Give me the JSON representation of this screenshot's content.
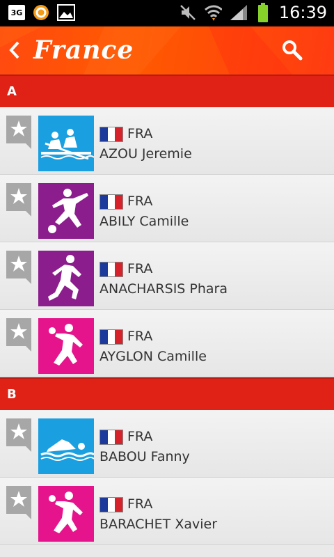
{
  "status_bar": {
    "network_badge": "3G",
    "time": "16:39",
    "icons": [
      "3g-icon",
      "circle-app-icon",
      "image-icon",
      "mute-icon",
      "wifi-icon",
      "signal-icon",
      "battery-icon"
    ],
    "battery_color": "#86d22b"
  },
  "header": {
    "title": "France",
    "back_icon": "chevron-left-icon",
    "search_icon": "search-icon",
    "colors": {
      "bar": "#ff5a00",
      "section": "#e02116"
    }
  },
  "sections": [
    {
      "letter": "A",
      "athletes": [
        {
          "country": "FRA",
          "name": "AZOU Jeremie",
          "sport_icon": "rowing-icon",
          "sport_color": "#1a9fe0"
        },
        {
          "country": "FRA",
          "name": "ABILY Camille",
          "sport_icon": "football-icon",
          "sport_color": "#8c1d8d"
        },
        {
          "country": "FRA",
          "name": "ANACHARSIS Phara",
          "sport_icon": "athletics-icon",
          "sport_color": "#8c1d8d"
        },
        {
          "country": "FRA",
          "name": "AYGLON Camille",
          "sport_icon": "handball-icon",
          "sport_color": "#e6148c"
        }
      ]
    },
    {
      "letter": "B",
      "athletes": [
        {
          "country": "FRA",
          "name": "BABOU Fanny",
          "sport_icon": "swimming-icon",
          "sport_color": "#1a9fe0"
        },
        {
          "country": "FRA",
          "name": "BARACHET Xavier",
          "sport_icon": "handball-icon",
          "sport_color": "#e6148c"
        }
      ]
    }
  ]
}
